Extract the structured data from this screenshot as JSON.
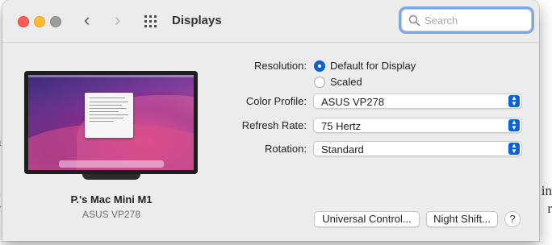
{
  "window": {
    "title": "Displays",
    "search_placeholder": "Search"
  },
  "display": {
    "name": "P.'s Mac Mini M1",
    "model": "ASUS VP278"
  },
  "settings": {
    "resolution_label": "Resolution:",
    "resolution_options": [
      {
        "label": "Default for Display",
        "selected": true
      },
      {
        "label": "Scaled",
        "selected": false
      }
    ],
    "color_profile_label": "Color Profile:",
    "color_profile_value": "ASUS VP278",
    "refresh_rate_label": "Refresh Rate:",
    "refresh_rate_value": "75 Hertz",
    "rotation_label": "Rotation:",
    "rotation_value": "Standard"
  },
  "buttons": {
    "universal_control": "Universal Control...",
    "night_shift": "Night Shift...",
    "help": "?"
  },
  "background": {
    "left_edge_chars": [
      "n",
      "a",
      "y"
    ],
    "right_edge_chars": [
      "in",
      "r"
    ]
  },
  "colors": {
    "accent": "#0a63d6",
    "close": "#ff5f57",
    "minimize": "#febc2e",
    "search_focus": "#7aa9e8"
  }
}
